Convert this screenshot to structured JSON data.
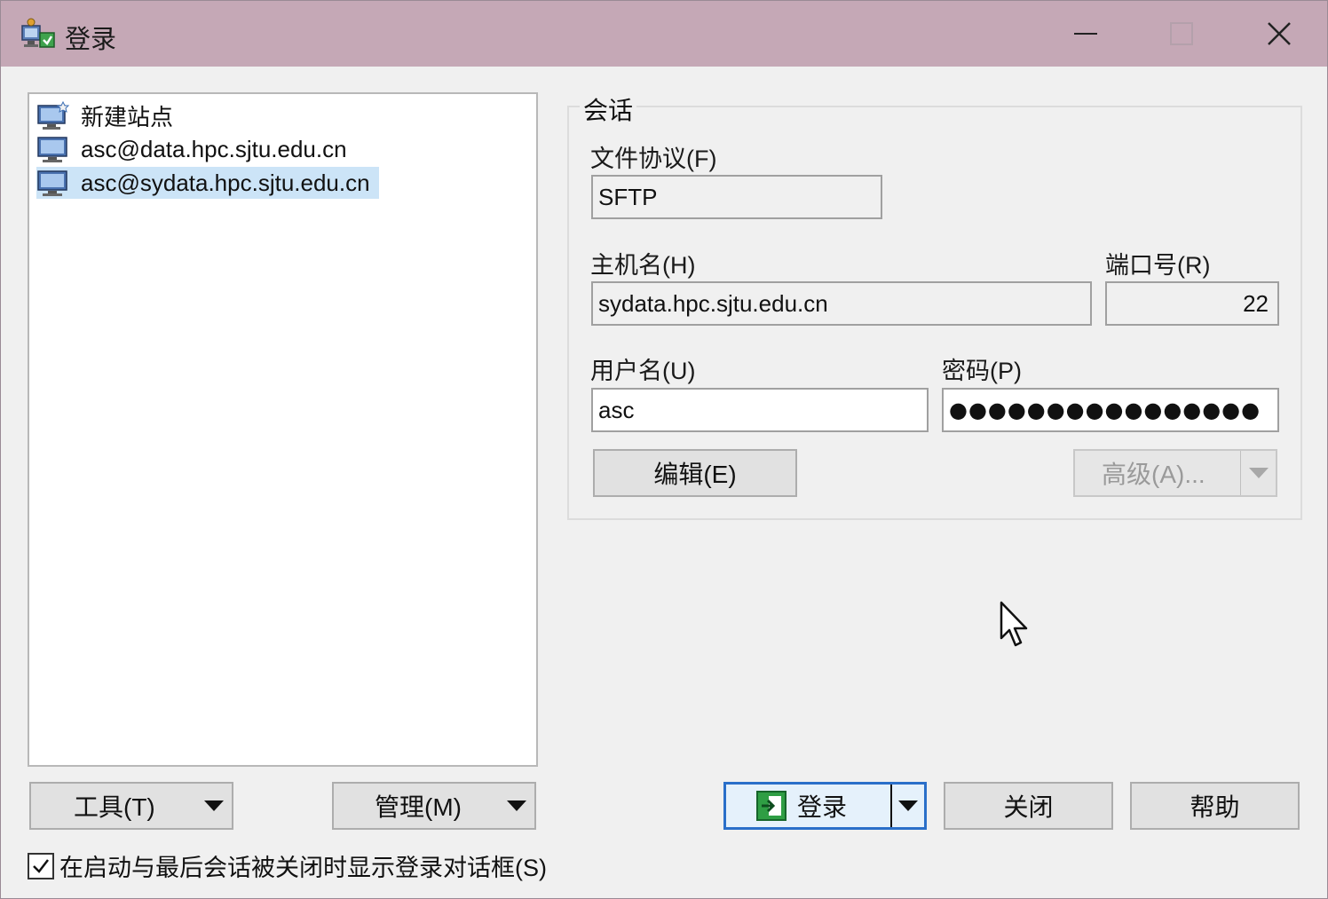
{
  "window": {
    "title": "登录",
    "controls": {
      "minimize": "minimize-icon",
      "maximize": "maximize-icon",
      "close": "close-icon"
    }
  },
  "site_tree": {
    "items": [
      {
        "label": "新建站点",
        "icon": "new-site-icon",
        "selected": false
      },
      {
        "label": "asc@data.hpc.sjtu.edu.cn",
        "icon": "computer-icon",
        "selected": false
      },
      {
        "label": "asc@sydata.hpc.sjtu.edu.cn",
        "icon": "computer-icon",
        "selected": true
      }
    ]
  },
  "session": {
    "group_title": "会话",
    "protocol_label": "文件协议(F)",
    "protocol_value": "SFTP",
    "host_label": "主机名(H)",
    "host_value": "sydata.hpc.sjtu.edu.cn",
    "port_label": "端口号(R)",
    "port_value": "22",
    "user_label": "用户名(U)",
    "user_value": "asc",
    "password_label": "密码(P)",
    "password_value": "●●●●●●●●●●●●●●●●",
    "edit_button": "编辑(E)",
    "advanced_button": "高级(A)..."
  },
  "buttons": {
    "tools": "工具(T)",
    "manage": "管理(M)",
    "login": "登录",
    "close": "关闭",
    "help": "帮助"
  },
  "footer": {
    "checkbox_label": "在启动与最后会话被关闭时显示登录对话框(S)",
    "checkbox_checked": true
  },
  "colors": {
    "titlebar": "#c5a8b6",
    "selection": "#cce4f7",
    "primary_border": "#2a6fc9"
  }
}
